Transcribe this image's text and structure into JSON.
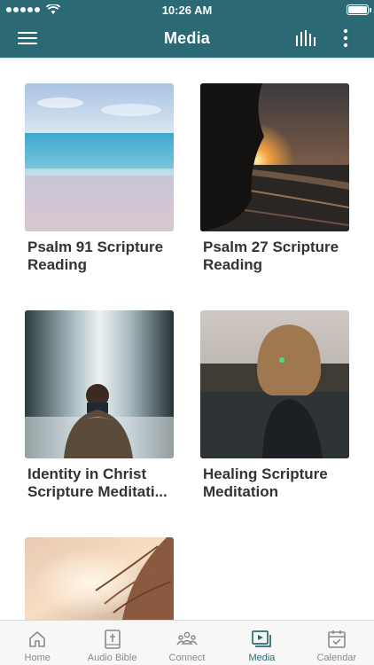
{
  "status_bar": {
    "time": "10:26 AM"
  },
  "app_bar": {
    "title": "Media"
  },
  "media_items": [
    {
      "title": "Psalm 91 Scripture Reading"
    },
    {
      "title": "Psalm 27 Scripture Reading"
    },
    {
      "title": "Identity in Christ Scripture Meditati..."
    },
    {
      "title": "Healing Scripture Meditation"
    }
  ],
  "tabs": [
    {
      "label": "Home",
      "icon": "home-icon"
    },
    {
      "label": "Audio Bible",
      "icon": "bible-icon"
    },
    {
      "label": "Connect",
      "icon": "group-icon"
    },
    {
      "label": "Media",
      "icon": "media-icon",
      "active": true
    },
    {
      "label": "Calendar",
      "icon": "calendar-icon"
    }
  ],
  "colors": {
    "brand": "#2b6a74",
    "tab_inactive": "#8a8a8a",
    "title_text": "#333333"
  }
}
